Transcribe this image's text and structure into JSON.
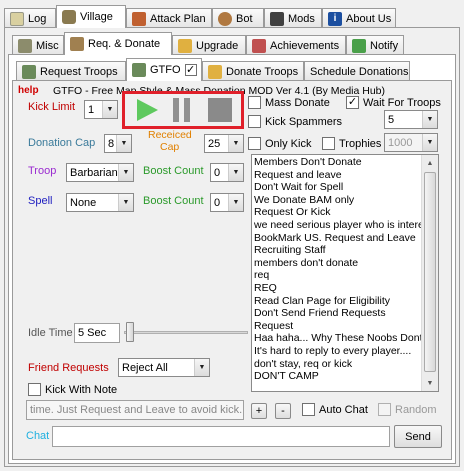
{
  "main_tabs": [
    {
      "label": "Log"
    },
    {
      "label": "Village"
    },
    {
      "label": "Attack Plan"
    },
    {
      "label": "Bot"
    },
    {
      "label": "Mods"
    },
    {
      "label": "About Us"
    }
  ],
  "sub_tabs": [
    {
      "label": "Misc"
    },
    {
      "label": "Req. & Donate"
    },
    {
      "label": "Upgrade"
    },
    {
      "label": "Achievements"
    },
    {
      "label": "Notify"
    }
  ],
  "inner_tabs": [
    {
      "label": "Request Troops"
    },
    {
      "label": "GTFO"
    },
    {
      "label": "Donate Troops"
    },
    {
      "label": "Schedule Donations"
    }
  ],
  "gtfo": {
    "help_label": "help",
    "title": "GTFO - Free Map Style & Mass Donation MOD  Ver 4.1 (By Media Hub)",
    "kick_limit_label": "Kick Limit",
    "kick_limit_value": "1",
    "donation_cap_label": "Donation Cap",
    "donation_cap_value": "8",
    "received_cap_label_1": "Receiced",
    "received_cap_label_2": "Cap",
    "received_cap_value": "25",
    "troop_label": "Troop",
    "troop_value": "Barbarian",
    "boost_count_label_1": "Boost Count",
    "boost_count_value_1": "0",
    "spell_label": "Spell",
    "spell_value": "None",
    "boost_count_label_2": "Boost Count",
    "boost_count_value_2": "0",
    "idle_time_label": "Idle Time",
    "idle_time_value": "5 Sec",
    "idle_slider_fraction": 0.0,
    "friend_requests_label": "Friend Requests",
    "friend_requests_value": "Reject All",
    "kick_with_note_label": "Kick With Note",
    "kick_note_text": "time. Just Request and Leave to avoid kick.",
    "add_label": "+",
    "remove_label": "-",
    "auto_chat_label": "Auto Chat",
    "random_label": "Random",
    "chat_label": "Chat",
    "chat_value": "",
    "send_label": "Send",
    "mass_donate_label": "Mass Donate",
    "mass_donate_checked": false,
    "wait_for_troops_label": "Wait For Troops",
    "wait_for_troops_checked": true,
    "kick_spammers_label": "Kick Spammers",
    "kick_spammers_value": "5",
    "only_kick_label": "Only Kick",
    "trophies_label": "Trophies",
    "trophies_value": "1000",
    "messages": [
      "Members Don't Donate",
      "Request and leave",
      "Don't Wait for Spell",
      "We Donate BAM only",
      "Request Or Kick",
      "we need serious player who is interested",
      "BookMark US. Request and Leave",
      "Recruiting Staff",
      "members don't donate",
      "req",
      "REQ",
      "Read Clan Page for Eligibility",
      "Don't Send Friend Requests",
      "Request",
      "Haa haha... Why These Noobs Dont",
      "It's hard to reply to every player....",
      "don't stay, req or kick",
      "DON'T CAMP"
    ]
  },
  "colors": {
    "highlight_box": "#e0202a",
    "play_green": "#5ec95e",
    "pause_gray": "#909090",
    "stop_gray": "#8a8a8a",
    "help_red": "#d00000"
  }
}
